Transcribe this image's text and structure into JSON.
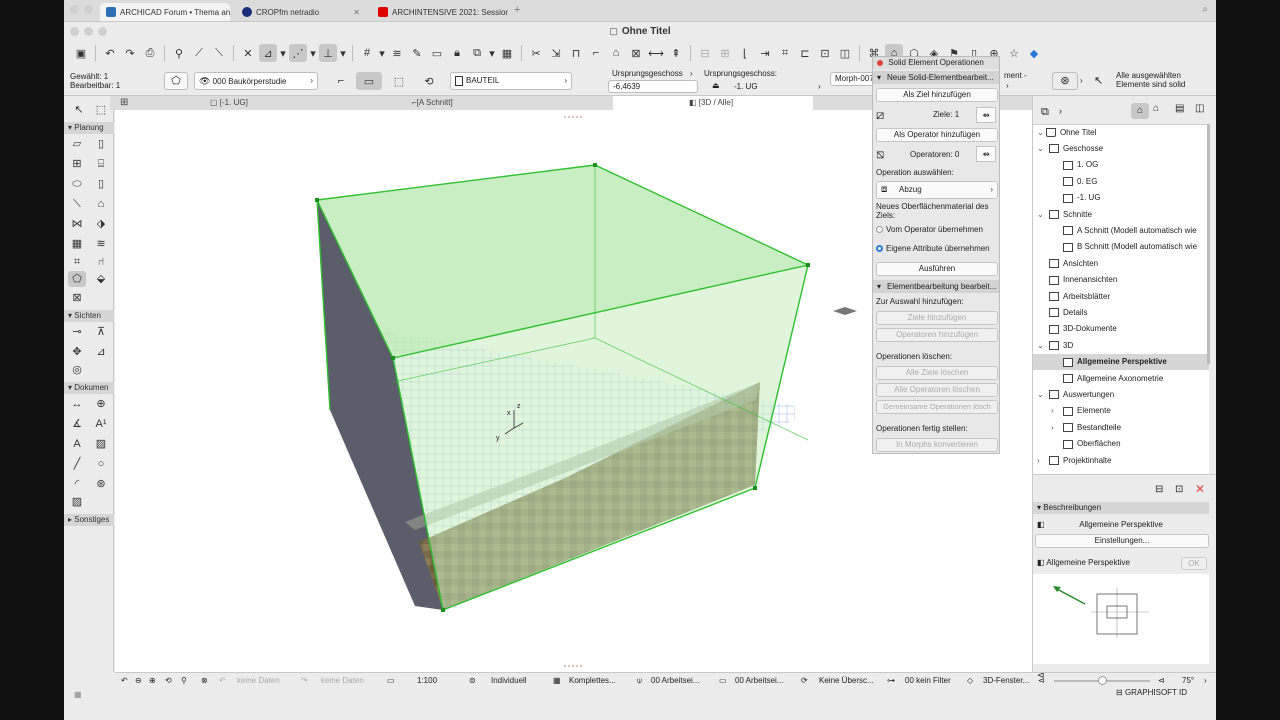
{
  "browser_tabs": [
    {
      "label": "ARCHICAD Forum • Thema anz",
      "color": "#2e6fb5"
    },
    {
      "label": "CROPfm netradio",
      "color": "#1b2a7a"
    },
    {
      "label": "ARCHINTENSIVE 2021: Session",
      "color": "#e00000"
    }
  ],
  "window": {
    "title": "Ohne Titel"
  },
  "infobox": {
    "selected": "Gewählt: 1",
    "editable": "Bearbeitbar: 1",
    "layer": "000 Baukörperstudie",
    "building_material": "BAUTEIL",
    "home_story_label": "Ursprungsgeschoss",
    "offset_value": "-6,4639",
    "home_story_label2": "Ursprungsgeschoss:",
    "home_story_value": "-1. UG",
    "id_value": "Morph-007",
    "element_label": "ment -",
    "status_line1": "Alle ausgewählten",
    "status_line2": "Elemente sind solid"
  },
  "view_tabs": [
    "[-1. UG]",
    "[A Schnitt]",
    "[3D / Alle]"
  ],
  "toolbox": {
    "sections": [
      "Planung",
      "Sichten",
      "Dokumen",
      "Sonstiges"
    ]
  },
  "palette": {
    "title": "Solid Element Operationen",
    "section1": "Neue Solid-Elementbearbeit...",
    "btn_target": "Als Ziel hinzufügen",
    "targets": "Ziele: 1",
    "btn_operator": "Als Operator hinzufügen",
    "operators": "Operatoren: 0",
    "op_select_label": "Operation auswählen:",
    "op_value": "Abzug",
    "material_label": "Neues Oberflächenmaterial des Ziels:",
    "radio1": "Vom Operator übernehmen",
    "radio2": "Eigene Attribute übernehmen",
    "btn_execute": "Ausführen",
    "section2": "Elementbearbeitung bearbeit...",
    "add_label": "Zur Auswahl hinzufügen:",
    "btn_add_targets": "Ziele hinzufügen",
    "btn_add_operators": "Operatoren hinzufügen",
    "delete_label": "Operationen löschen:",
    "btn_del_targets": "Alle Ziele löschen",
    "btn_del_operators": "Alle Operatoren löschen",
    "btn_del_shared": "Gemeinsame Operationen lösch",
    "finish_label": "Operationen fertig stellen:",
    "btn_convert": "In Morphs konvertieren"
  },
  "navigator": {
    "root": "Ohne Titel",
    "items": [
      {
        "label": "Geschosse",
        "indent": 1
      },
      {
        "label": "1. OG",
        "indent": 2
      },
      {
        "label": "0. EG",
        "indent": 2
      },
      {
        "label": "-1. UG",
        "indent": 2
      },
      {
        "label": "Schnitte",
        "indent": 1
      },
      {
        "label": "A Schnitt (Modell automatisch wie",
        "indent": 2
      },
      {
        "label": "B Schnitt (Modell automatisch wie",
        "indent": 2
      },
      {
        "label": "Ansichten",
        "indent": 1
      },
      {
        "label": "Innenansichten",
        "indent": 1
      },
      {
        "label": "Arbeitsblätter",
        "indent": 1
      },
      {
        "label": "Details",
        "indent": 1
      },
      {
        "label": "3D-Dokumente",
        "indent": 1
      },
      {
        "label": "3D",
        "indent": 1
      },
      {
        "label": "Allgemeine Perspektive",
        "indent": 2,
        "selected": true
      },
      {
        "label": "Allgemeine Axonometrie",
        "indent": 2
      },
      {
        "label": "Auswertungen",
        "indent": 1
      },
      {
        "label": "Elemente",
        "indent": 2
      },
      {
        "label": "Bestandteile",
        "indent": 2
      },
      {
        "label": "Oberflächen",
        "indent": 2
      },
      {
        "label": "Projektinhalte",
        "indent": 1
      }
    ],
    "desc_header": "Beschreibungen",
    "desc_name": "Allgemeine Perspektive",
    "settings_btn": "Einstellungen...",
    "view_name": "Allgemeine Perspektive",
    "ok_btn": "OK",
    "angle": "75°",
    "brand": "GRAPHISOFT ID"
  },
  "statusbar": {
    "no_data1": "keine Daten",
    "no_data2": "keine Daten",
    "scale": "1:100",
    "pen_set": "Individuell",
    "model_view": "Komplettes...",
    "layer_combo1": "00 Arbeitsei...",
    "layer_combo2": "00 Arbeitsei...",
    "override": "Keine Übersc...",
    "filter": "00 kein Filter",
    "window_3d": "3D-Fenster..."
  },
  "colors": {
    "accent": "#2a79d8",
    "selection_green": "#3cc83c",
    "box_fill": "#b8e8b0"
  }
}
